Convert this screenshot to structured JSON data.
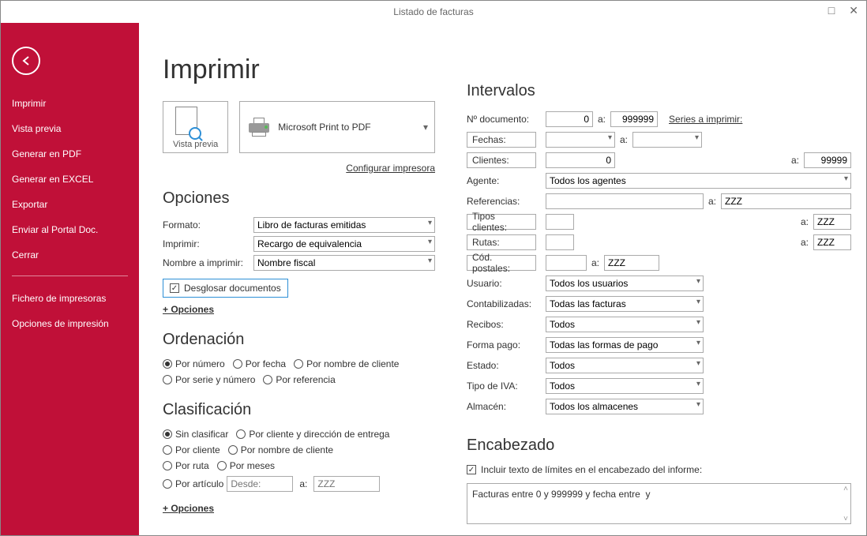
{
  "titlebar": {
    "title": "Listado de facturas"
  },
  "sidebar": {
    "items": [
      "Imprimir",
      "Vista previa",
      "Generar en PDF",
      "Generar en EXCEL",
      "Exportar",
      "Enviar al Portal Doc.",
      "Cerrar",
      "Fichero de impresoras",
      "Opciones de impresión"
    ]
  },
  "page": {
    "title": "Imprimir",
    "preview_label": "Vista previa",
    "printer_selected": "Microsoft Print to PDF",
    "config_link": "Configurar impresora"
  },
  "opciones": {
    "title": "Opciones",
    "formato_label": "Formato:",
    "formato_value": "Libro de facturas emitidas",
    "imprimir_label": "Imprimir:",
    "imprimir_value": "Recargo de equivalencia",
    "nombre_label": "Nombre a imprimir:",
    "nombre_value": "Nombre fiscal",
    "desglosar": "Desglosar documentos",
    "mas_opciones": "+ Opciones"
  },
  "ordenacion": {
    "title": "Ordenación",
    "por_numero": "Por número",
    "por_fecha": "Por fecha",
    "por_nombre_cliente": "Por nombre de cliente",
    "por_serie_numero": "Por serie y número",
    "por_referencia": "Por referencia",
    "selected": "por_numero"
  },
  "clasificacion": {
    "title": "Clasificación",
    "sin_clasificar": "Sin clasificar",
    "por_cliente_dir": "Por cliente y dirección de entrega",
    "por_cliente": "Por cliente",
    "por_nombre_cliente": "Por nombre de cliente",
    "por_ruta": "Por ruta",
    "por_meses": "Por meses",
    "por_articulo": "Por artículo",
    "desde_ph": "Desde:",
    "a_label": "a:",
    "a_ph": "ZZZ",
    "mas_opciones": "+ Opciones",
    "selected": "sin_clasificar"
  },
  "intervalos": {
    "title": "Intervalos",
    "ndoc_label": "Nº documento:",
    "ndoc_from": "0",
    "a_label": "a:",
    "ndoc_to": "999999",
    "series_link": "Series a imprimir:",
    "fechas_label": "Fechas:",
    "fechas_from": "",
    "fechas_to": "",
    "clientes_label": "Clientes:",
    "clientes_from": "0",
    "clientes_to": "99999",
    "agente_label": "Agente:",
    "agente_value": "Todos los agentes",
    "ref_label": "Referencias:",
    "ref_from": "",
    "ref_to": "ZZZ",
    "tipos_label": "Tipos clientes:",
    "tipos_from": "",
    "tipos_to": "ZZZ",
    "rutas_label": "Rutas:",
    "rutas_from": "",
    "rutas_to": "ZZZ",
    "cp_label": "Cód. postales:",
    "cp_from": "",
    "cp_a": "a:",
    "cp_to": "ZZZ",
    "usuario_label": "Usuario:",
    "usuario_value": "Todos los usuarios",
    "contab_label": "Contabilizadas:",
    "contab_value": "Todas las facturas",
    "recibos_label": "Recibos:",
    "recibos_value": "Todos",
    "formapago_label": "Forma pago:",
    "formapago_value": "Todas las formas de pago",
    "estado_label": "Estado:",
    "estado_value": "Todos",
    "tipoiva_label": "Tipo de IVA:",
    "tipoiva_value": "Todos",
    "almacen_label": "Almacén:",
    "almacen_value": "Todos los almacenes"
  },
  "encabezado": {
    "title": "Encabezado",
    "check_label": "Incluir texto de límites en el encabezado del informe:",
    "text": "Facturas entre 0 y 999999 y fecha entre  y"
  }
}
